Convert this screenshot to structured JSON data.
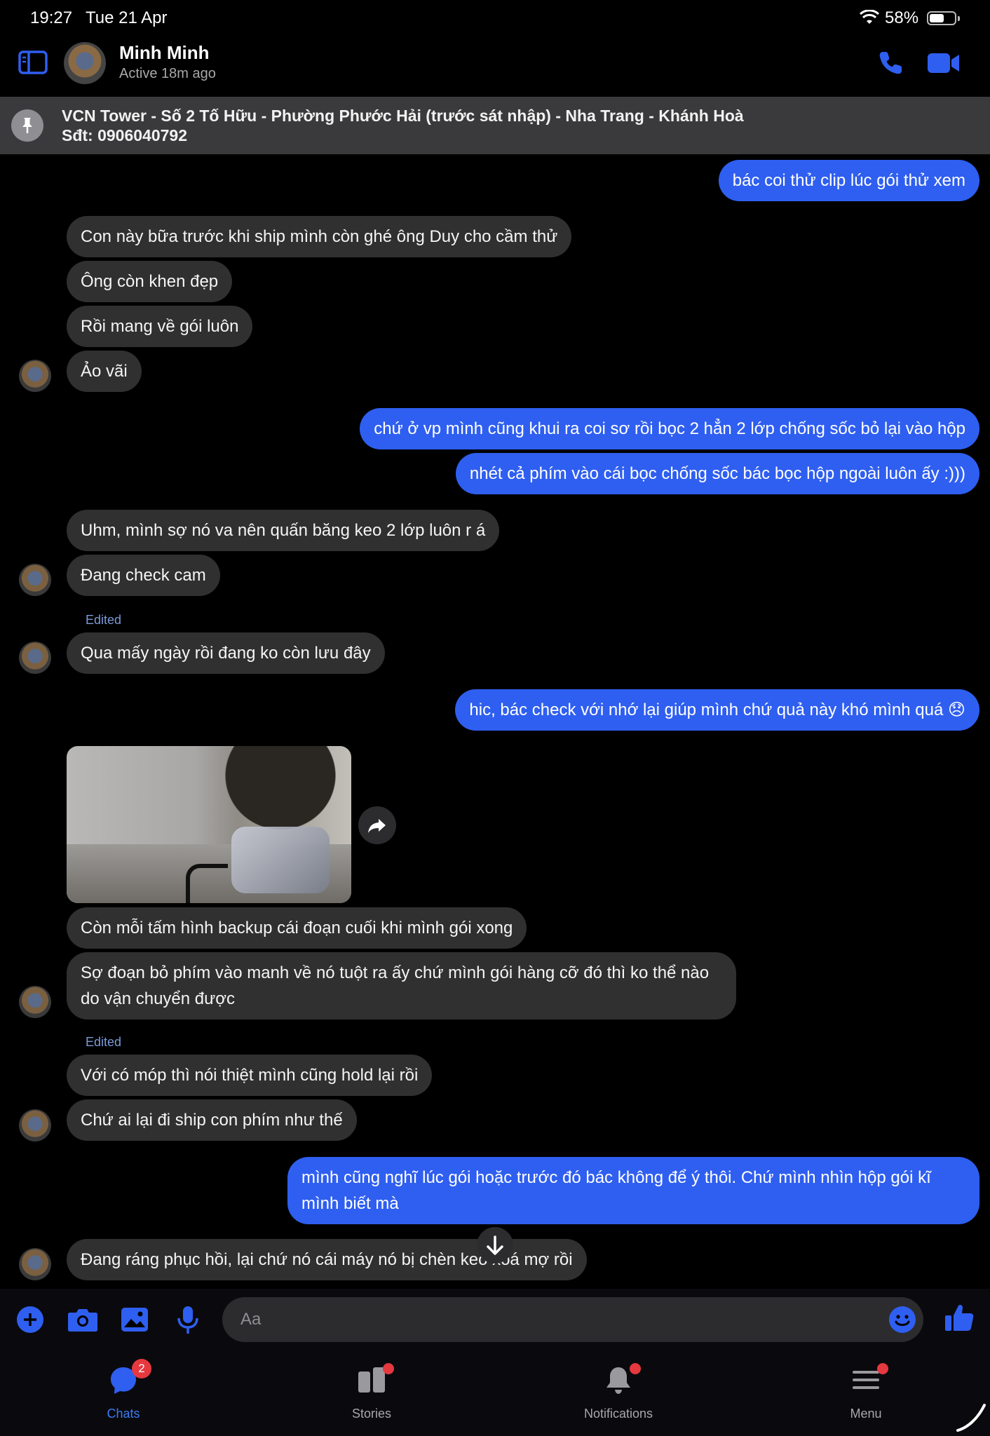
{
  "status_bar": {
    "time": "19:27",
    "date": "Tue 21 Apr",
    "battery": "58%"
  },
  "header": {
    "name": "Minh Minh",
    "status": "Active 18m ago"
  },
  "pinned": {
    "line1": "VCN Tower - Số 2 Tố Hữu - Phường Phước Hải (trước sát nhập) - Nha Trang - Khánh Hoà",
    "line2": "Sđt: 0906040792"
  },
  "messages": [
    {
      "text": "bác coi thử clip lúc gói thử xem"
    },
    {
      "text": "Con này bữa trước khi ship mình còn ghé ông Duy cho cầm thử"
    },
    {
      "text": "Ông còn khen đẹp"
    },
    {
      "text": "Rồi mang về gói luôn"
    },
    {
      "text": "Ảo vãi"
    },
    {
      "text": "chứ ở vp mình cũng khui ra coi sơ rồi bọc 2 hẳn 2 lớp chống sốc bỏ lại vào hộp"
    },
    {
      "text": "nhét cả phím vào cái bọc chống sốc bác bọc hộp ngoài luôn ấy :)))"
    },
    {
      "text": "Uhm, mình sợ nó va nên quấn băng keo 2 lớp luôn r á"
    },
    {
      "text": "Đang check cam"
    },
    {
      "text": "Qua mấy ngày rồi đang ko còn lưu đây"
    },
    {
      "text": "hic, bác check với nhớ lại giúp mình chứ quả này khó mình quá 😞"
    },
    {
      "text": "Còn mỗi tấm hình backup cái đoạn cuối khi mình gói xong"
    },
    {
      "text": "Sợ đoạn bỏ phím vào manh về nó tuột ra ấy chứ mình gói hàng cỡ đó thì ko thể nào do vận chuyển được"
    },
    {
      "text": "Với có móp thì nói thiệt mình cũng hold lại rồi"
    },
    {
      "text": "Chứ ai lại đi ship con phím như thế"
    },
    {
      "text": "mình cũng nghĩ lúc gói hoặc trước đó bác không để ý thôi. Chứ mình nhìn hộp gói kĩ mình biết mà"
    },
    {
      "text": "Đang ráng phục hồi, lại chứ nó cái máy nó bị chèn keo xoá mợ rồi"
    }
  ],
  "edited_label": "Edited",
  "composer": {
    "placeholder": "Aa"
  },
  "tabs": [
    {
      "label": "Chats",
      "badge": "2"
    },
    {
      "label": "Stories"
    },
    {
      "label": "Notifications"
    },
    {
      "label": "Menu"
    }
  ],
  "colors": {
    "accent": "#2f5ff0",
    "incoming_bubble": "#303030",
    "background": "#000000",
    "badge": "#e5383f"
  }
}
